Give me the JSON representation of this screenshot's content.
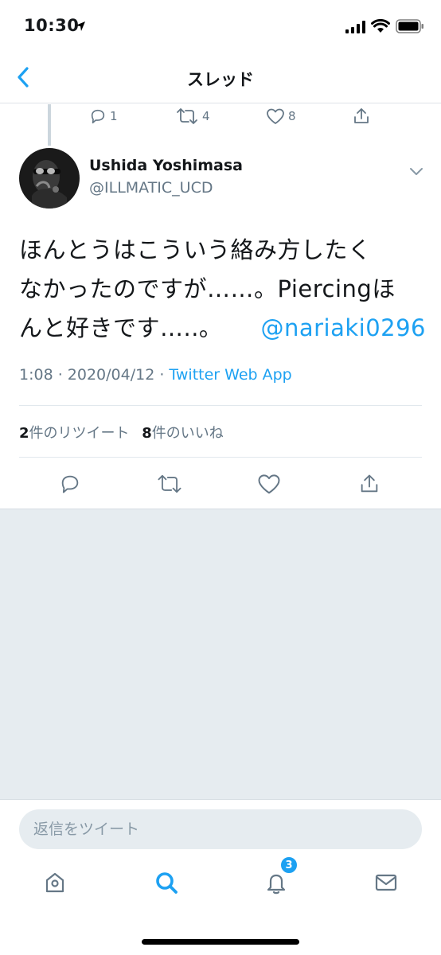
{
  "status_bar": {
    "time": "10:30"
  },
  "nav": {
    "title": "スレッド"
  },
  "previous_tweet": {
    "reply_count": "1",
    "retweet_count": "4",
    "like_count": "8"
  },
  "tweet": {
    "display_name": "Ushida Yoshimasa",
    "handle": "@ILLMATIC_UCD",
    "text_lines": [
      "ほんとうはこういう絡み方したく",
      "なかったのですが……。Piercingほ",
      "んと好きです…..。"
    ],
    "mention": "@nariaki0296",
    "timestamp": "1:08 · 2020/04/12 · ",
    "source": "Twitter Web App",
    "retweet_count": "2",
    "retweet_label": "件のリツイート",
    "like_count": "8",
    "like_label": "件のいいね"
  },
  "reply": {
    "placeholder": "返信をツイート"
  },
  "tab_bar": {
    "notification_badge": "3"
  },
  "colors": {
    "accent": "#1da1f2",
    "secondary_text": "#657786",
    "background_gray": "#e6ecf0"
  },
  "icons": [
    "location-arrow-icon",
    "signal-icon",
    "wifi-icon",
    "battery-icon",
    "chevron-left-icon",
    "reply-icon",
    "retweet-icon",
    "heart-icon",
    "share-icon",
    "chevron-down-icon",
    "home-icon",
    "search-icon",
    "bell-icon",
    "mail-icon"
  ]
}
